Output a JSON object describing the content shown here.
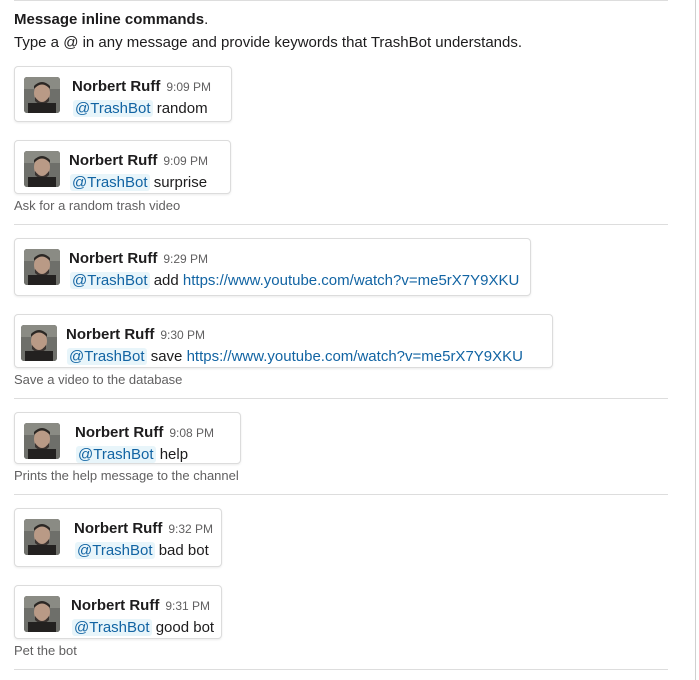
{
  "intro": {
    "title": "Message inline commands",
    "title_punct": ".",
    "body": "Type a @ in any message and provide keywords that TrashBot understands."
  },
  "groups": [
    {
      "caption": "Ask for a random trash video",
      "messages": [
        {
          "author": "Norbert Ruff",
          "time": "9:09 PM",
          "mention": "@TrashBot",
          "text": "random",
          "link": ""
        },
        {
          "author": "Norbert Ruff",
          "time": "9:09 PM",
          "mention": "@TrashBot",
          "text": "surprise",
          "link": ""
        }
      ]
    },
    {
      "caption": "Save a video to the database",
      "messages": [
        {
          "author": "Norbert Ruff",
          "time": "9:29 PM",
          "mention": "@TrashBot",
          "text": "add",
          "link": "https://www.youtube.com/watch?v=me5rX7Y9XKU"
        },
        {
          "author": "Norbert Ruff",
          "time": "9:30 PM",
          "mention": "@TrashBot",
          "text": "save",
          "link": "https://www.youtube.com/watch?v=me5rX7Y9XKU"
        }
      ]
    },
    {
      "caption": "Prints the help message to the channel",
      "messages": [
        {
          "author": "Norbert Ruff",
          "time": "9:08 PM",
          "mention": "@TrashBot",
          "text": "help",
          "link": ""
        }
      ]
    },
    {
      "caption": "Pet the bot",
      "messages": [
        {
          "author": "Norbert Ruff",
          "time": "9:32 PM",
          "mention": "@TrashBot",
          "text": "bad bot",
          "link": ""
        },
        {
          "author": "Norbert Ruff",
          "time": "9:31 PM",
          "mention": "@TrashBot",
          "text": "good bot",
          "link": ""
        }
      ]
    }
  ],
  "colors": {
    "mention_bg": "#e8f5fa",
    "link": "#1264a3",
    "caption": "#616061"
  },
  "icons": {
    "avatar": "user-avatar-photo"
  }
}
